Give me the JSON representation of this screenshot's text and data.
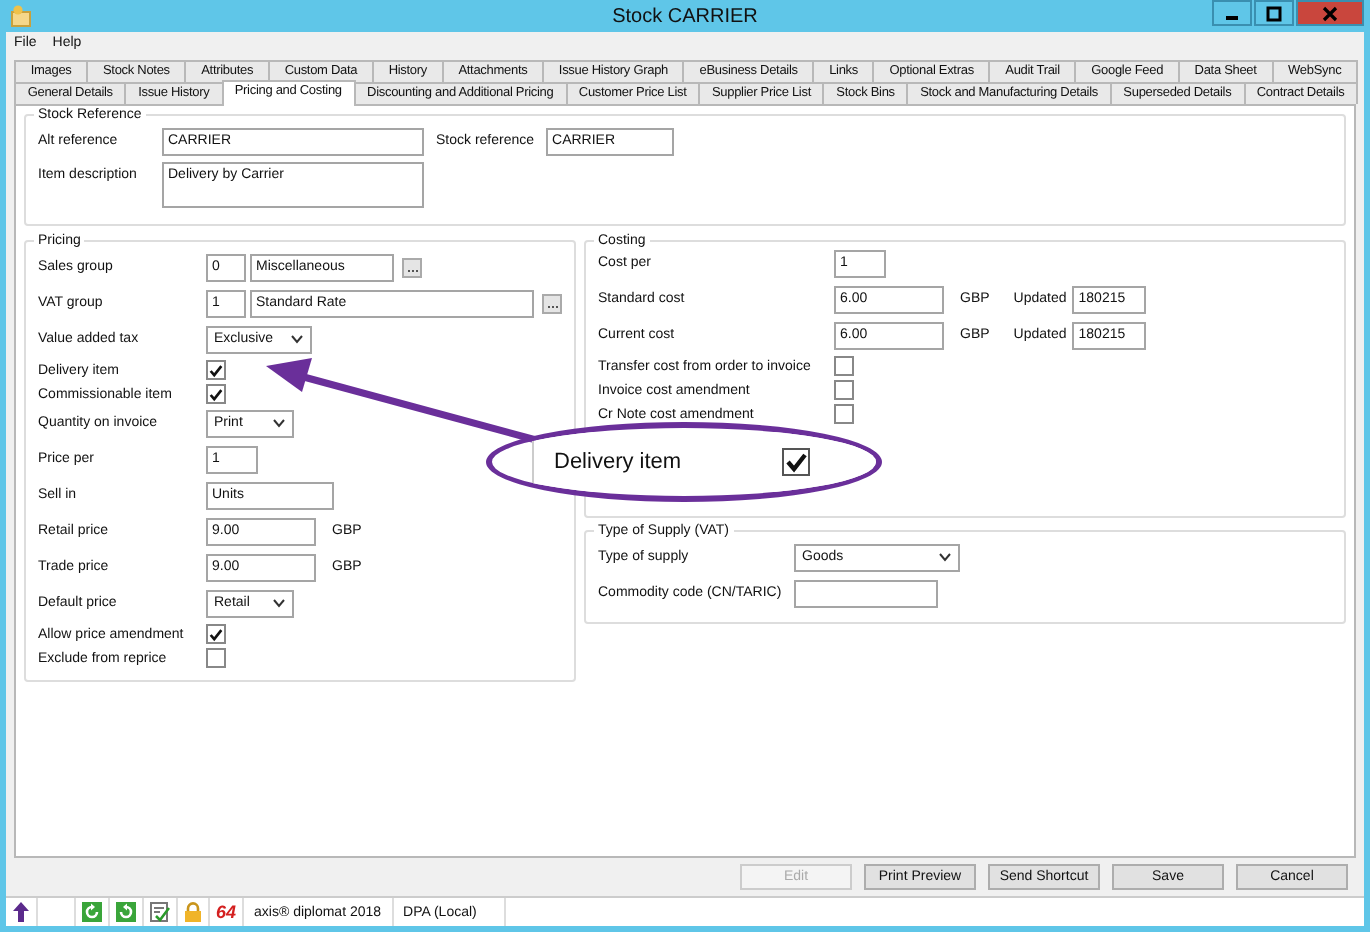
{
  "window": {
    "title": "Stock CARRIER"
  },
  "menu": [
    "File",
    "Help"
  ],
  "tab_rows": [
    [
      {
        "label": "Images",
        "selected": false
      },
      {
        "label": "Stock Notes",
        "selected": false
      },
      {
        "label": "Attributes",
        "selected": false
      },
      {
        "label": "Custom Data",
        "selected": false
      },
      {
        "label": "History",
        "selected": false
      },
      {
        "label": "Attachments",
        "selected": false
      },
      {
        "label": "Issue History Graph",
        "selected": false
      },
      {
        "label": "eBusiness Details",
        "selected": false
      },
      {
        "label": "Links",
        "selected": false
      },
      {
        "label": "Optional Extras",
        "selected": false
      },
      {
        "label": "Audit Trail",
        "selected": false
      },
      {
        "label": "Google Feed",
        "selected": false
      },
      {
        "label": "Data Sheet",
        "selected": false
      },
      {
        "label": "WebSync",
        "selected": false
      }
    ],
    [
      {
        "label": "General Details",
        "selected": false
      },
      {
        "label": "Issue History",
        "selected": false
      },
      {
        "label": "Pricing and Costing",
        "selected": true
      },
      {
        "label": "Discounting and Additional Pricing",
        "selected": false
      },
      {
        "label": "Customer Price List",
        "selected": false
      },
      {
        "label": "Supplier Price List",
        "selected": false
      },
      {
        "label": "Stock Bins",
        "selected": false
      },
      {
        "label": "Stock and Manufacturing Details",
        "selected": false
      },
      {
        "label": "Superseded Details",
        "selected": false
      },
      {
        "label": "Contract Details",
        "selected": false
      }
    ]
  ],
  "stock_reference": {
    "title": "Stock Reference",
    "alt_reference": {
      "label": "Alt reference",
      "value": "CARRIER"
    },
    "stock_reference": {
      "label": "Stock reference",
      "value": "CARRIER"
    },
    "item_description": {
      "label": "Item description",
      "value": "Delivery by Carrier"
    }
  },
  "pricing": {
    "title": "Pricing",
    "rows": [
      {
        "kind": "code",
        "label": "Sales group",
        "code": "0",
        "value": "Miscellaneous"
      },
      {
        "kind": "code_wide",
        "label": "VAT group",
        "code": "1",
        "value": "Standard Rate"
      },
      {
        "kind": "select",
        "label": "Value added tax",
        "value": "Exclusive"
      },
      {
        "kind": "checkbox",
        "label": "Delivery item",
        "checked": true
      },
      {
        "kind": "checkbox",
        "label": "Commissionable item",
        "checked": true
      },
      {
        "kind": "select",
        "label": "Quantity on invoice",
        "value": "Print"
      },
      {
        "kind": "input_small",
        "label": "Price per",
        "value": "1"
      },
      {
        "kind": "input",
        "label": "Sell in",
        "value": "Units"
      },
      {
        "kind": "money",
        "label": "Retail price",
        "value": "9.00",
        "unit": "GBP"
      },
      {
        "kind": "money",
        "label": "Trade price",
        "value": "9.00",
        "unit": "GBP"
      },
      {
        "kind": "select",
        "label": "Default price",
        "value": "Retail"
      },
      {
        "kind": "checkbox",
        "label": "Allow price amendment",
        "checked": true
      },
      {
        "kind": "checkbox",
        "label": "Exclude from reprice",
        "checked": false
      }
    ]
  },
  "costing": {
    "title": "Costing",
    "rows": [
      {
        "kind": "input_small",
        "label": "Cost per",
        "value": "1"
      },
      {
        "kind": "cost",
        "label": "Standard cost",
        "value": "6.00",
        "unit": "GBP",
        "updated_label": "Updated",
        "updated": "180215"
      },
      {
        "kind": "cost",
        "label": "Current cost",
        "value": "6.00",
        "unit": "GBP",
        "updated_label": "Updated",
        "updated": "180215"
      },
      {
        "kind": "checkbox",
        "label": "Transfer cost from order to invoice",
        "checked": false
      },
      {
        "kind": "checkbox",
        "label": "Invoice cost amendment",
        "checked": false
      },
      {
        "kind": "checkbox",
        "label": "Cr Note cost amendment",
        "checked": false
      }
    ]
  },
  "type_of_supply": {
    "title": "Type of Supply (VAT)",
    "rows": [
      {
        "kind": "select",
        "label": "Type of supply",
        "value": "Goods"
      },
      {
        "kind": "input",
        "label": "Commodity code (CN/TARIC)",
        "value": ""
      }
    ]
  },
  "buttons": [
    {
      "label": "Edit",
      "disabled": true
    },
    {
      "label": "Print Preview",
      "disabled": false
    },
    {
      "label": "Send Shortcut",
      "disabled": false
    },
    {
      "label": "Save",
      "disabled": false
    },
    {
      "label": "Cancel",
      "disabled": false
    }
  ],
  "status_bar": {
    "badge": "64",
    "product": "axis® diplomat 2018",
    "connection": "DPA (Local)"
  },
  "callout": {
    "label": "Delivery item",
    "checked": true
  }
}
